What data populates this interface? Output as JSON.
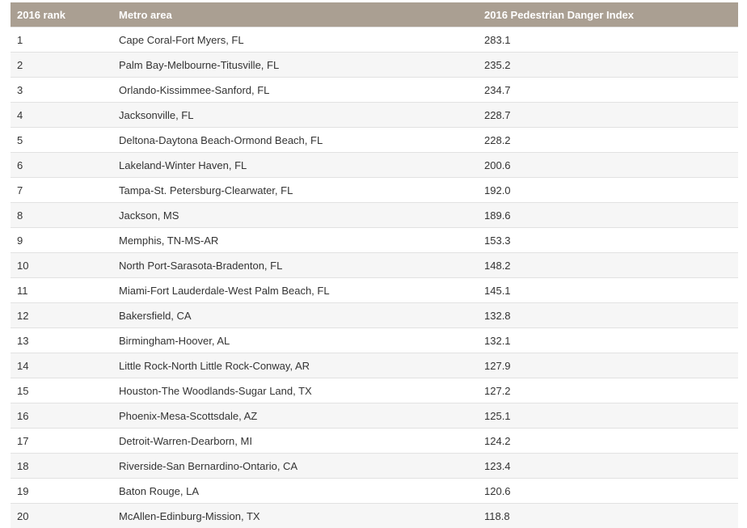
{
  "table": {
    "headers": [
      "2016 rank",
      "Metro area",
      "2016 Pedestrian Danger Index"
    ],
    "rows": [
      [
        "1",
        "Cape Coral-Fort Myers, FL",
        "283.1"
      ],
      [
        "2",
        "Palm Bay-Melbourne-Titusville, FL",
        "235.2"
      ],
      [
        "3",
        "Orlando-Kissimmee-Sanford, FL",
        "234.7"
      ],
      [
        "4",
        "Jacksonville, FL",
        "228.7"
      ],
      [
        "5",
        "Deltona-Daytona Beach-Ormond Beach, FL",
        "228.2"
      ],
      [
        "6",
        "Lakeland-Winter Haven, FL",
        "200.6"
      ],
      [
        "7",
        "Tampa-St. Petersburg-Clearwater, FL",
        "192.0"
      ],
      [
        "8",
        "Jackson, MS",
        "189.6"
      ],
      [
        "9",
        "Memphis, TN-MS-AR",
        "153.3"
      ],
      [
        "10",
        "North Port-Sarasota-Bradenton, FL",
        "148.2"
      ],
      [
        "11",
        "Miami-Fort Lauderdale-West Palm Beach, FL",
        "145.1"
      ],
      [
        "12",
        "Bakersfield, CA",
        "132.8"
      ],
      [
        "13",
        "Birmingham-Hoover, AL",
        "132.1"
      ],
      [
        "14",
        "Little Rock-North Little Rock-Conway, AR",
        "127.9"
      ],
      [
        "15",
        "Houston-The Woodlands-Sugar Land, TX",
        "127.2"
      ],
      [
        "16",
        "Phoenix-Mesa-Scottsdale, AZ",
        "125.1"
      ],
      [
        "17",
        "Detroit-Warren-Dearborn, MI",
        "124.2"
      ],
      [
        "18",
        "Riverside-San Bernardino-Ontario, CA",
        "123.4"
      ],
      [
        "19",
        "Baton Rouge, LA",
        "120.6"
      ],
      [
        "20",
        "McAllen-Edinburg-Mission, TX",
        "118.8"
      ]
    ]
  },
  "colors": {
    "header_background": "#aa9f92",
    "header_text": "#ffffff",
    "row_alt_background": "#f6f6f6",
    "row_border": "#e2e2e2",
    "body_text": "#333333"
  }
}
